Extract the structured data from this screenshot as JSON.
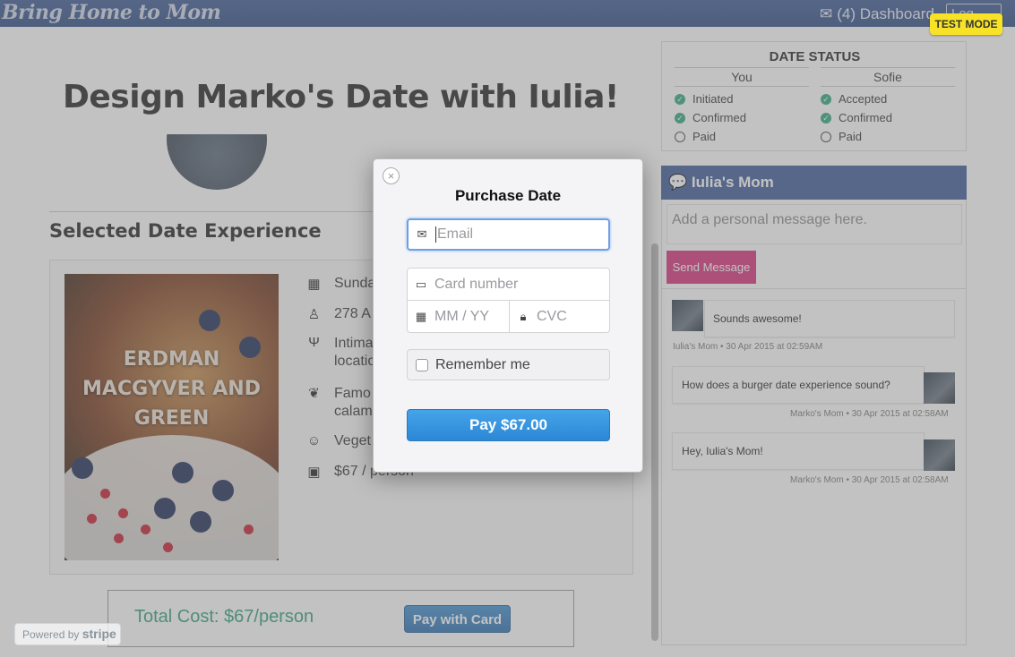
{
  "nav": {
    "brand": "Bring Home to Mom",
    "dashboard": "(4) Dashboard",
    "logout": "Log Out",
    "test_mode": "TEST MODE"
  },
  "page": {
    "headline": "Design Marko's Date with Iulia!",
    "selected_title": "Selected Date Experience",
    "restaurant_overlay": "ERDMAN MACGYVER AND GREEN",
    "details": [
      {
        "icon": "calendar-icon",
        "text": "Sunda"
      },
      {
        "icon": "location-icon",
        "text": "278 A"
      },
      {
        "icon": "utensils-icon",
        "text": "Intima",
        "text2": "locatio"
      },
      {
        "icon": "leaf-icon",
        "text": "Famo",
        "text2": "calam"
      },
      {
        "icon": "smile-icon",
        "text": "Veget"
      },
      {
        "icon": "money-icon",
        "text": "$67 / person"
      }
    ],
    "total": "Total Cost: $67/person",
    "pay_with_card": "Pay with Card",
    "stripe_badge_prefix": "Powered by",
    "stripe_badge_brand": "stripe"
  },
  "status": {
    "title": "DATE STATUS",
    "you": {
      "header": "You",
      "items": [
        {
          "label": "Initiated",
          "done": true
        },
        {
          "label": "Confirmed",
          "done": true
        },
        {
          "label": "Paid",
          "done": false
        }
      ]
    },
    "other": {
      "header": "Sofie",
      "items": [
        {
          "label": "Accepted",
          "done": true
        },
        {
          "label": "Confirmed",
          "done": true
        },
        {
          "label": "Paid",
          "done": false
        }
      ]
    }
  },
  "chat": {
    "title": "Iulia's Mom",
    "placeholder": "Add a personal message here.",
    "send": "Send Message",
    "messages": [
      {
        "text": "Sounds awesome!",
        "meta": "Iulia's Mom • 30 Apr 2015 at 02:59AM"
      },
      {
        "text": "How does a burger date experience sound?",
        "meta": "Marko's Mom • 30 Apr 2015 at 02:58AM"
      },
      {
        "text": "Hey, Iulia's Mom!",
        "meta": "Marko's Mom • 30 Apr 2015 at 02:58AM"
      }
    ]
  },
  "modal": {
    "title": "Purchase Date",
    "close": "×",
    "email_placeholder": "Email",
    "card_placeholder": "Card number",
    "expiry_placeholder": "MM / YY",
    "cvc_placeholder": "CVC",
    "remember": "Remember me",
    "pay": "Pay $67.00"
  },
  "colors": {
    "nav": "#2d4a82",
    "accent_green": "#2e9e76",
    "send_pink": "#d9307a",
    "pay_blue": "#2c87d5",
    "test_mode": "#f7e227"
  }
}
